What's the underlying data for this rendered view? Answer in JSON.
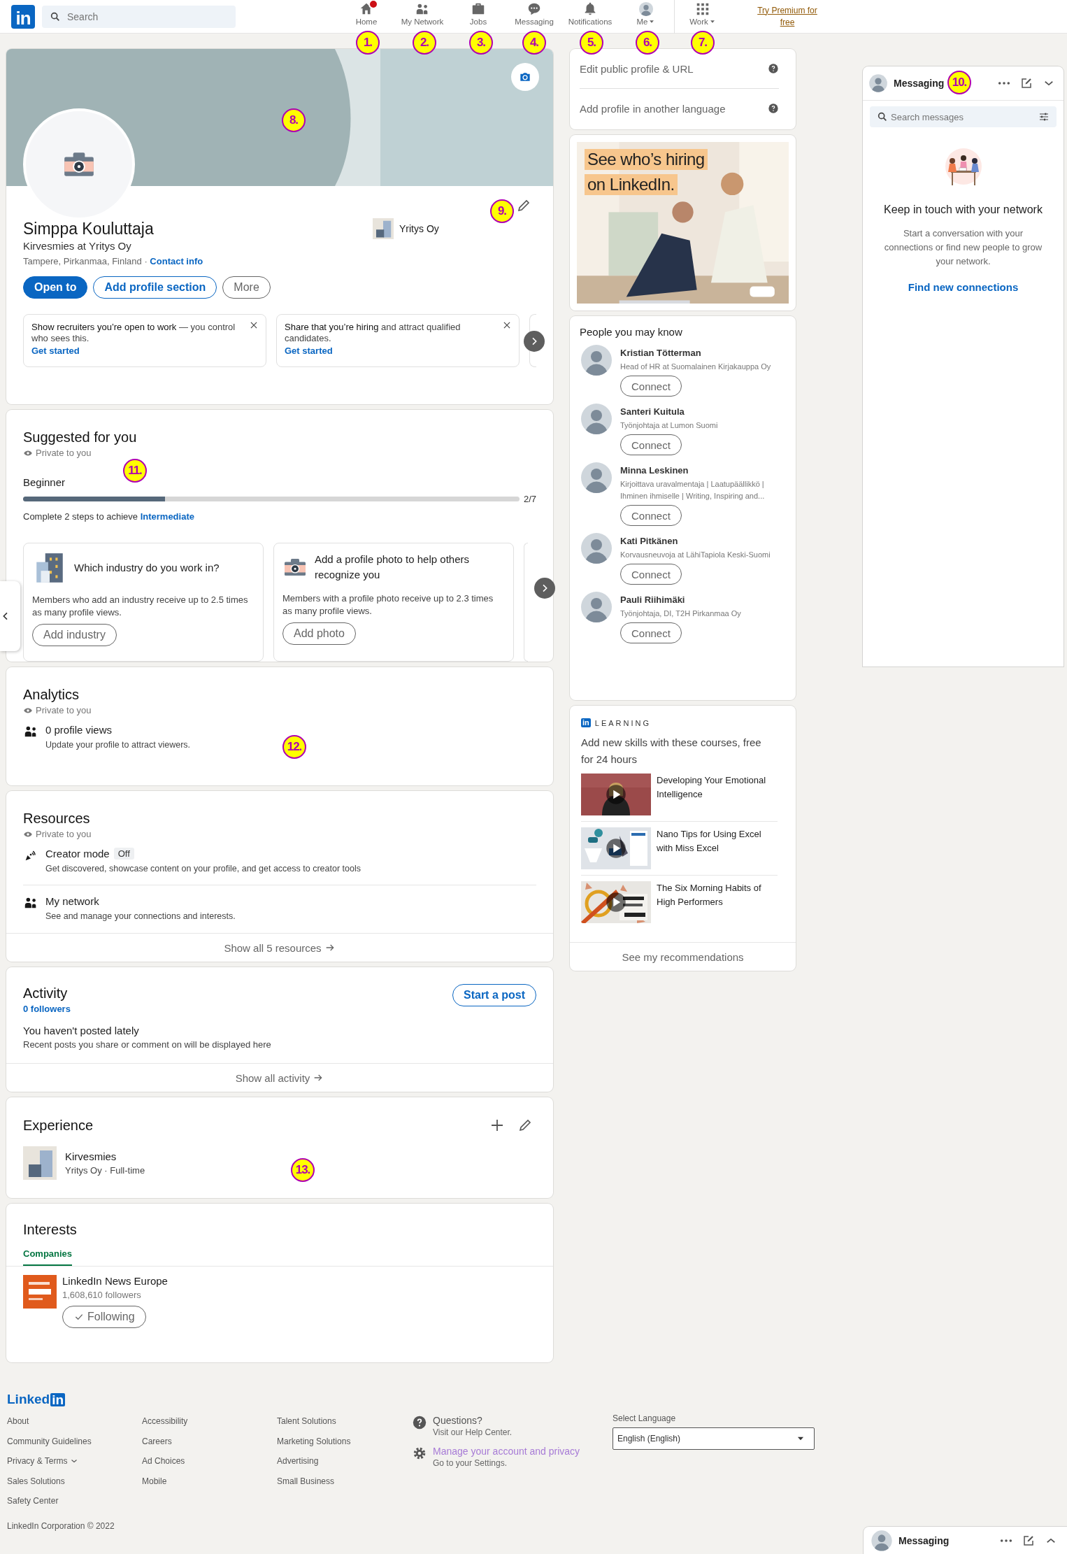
{
  "nav": {
    "logo": "in",
    "search": {
      "placeholder": "Search"
    },
    "items": [
      {
        "label": "Home",
        "badge": true,
        "dropdown": false
      },
      {
        "label": "My Network",
        "badge": false,
        "dropdown": false
      },
      {
        "label": "Jobs",
        "badge": false,
        "dropdown": false
      },
      {
        "label": "Messaging",
        "badge": false,
        "dropdown": false
      },
      {
        "label": "Notifications",
        "badge": false,
        "dropdown": false
      },
      {
        "label": "Me",
        "badge": false,
        "dropdown": true
      },
      {
        "label": "Work",
        "badge": false,
        "dropdown": true
      }
    ],
    "premium": "Try Premium for free"
  },
  "profile": {
    "name": "Simppa Kouluttaja",
    "headline": "Kirvesmies at Yritys Oy",
    "location": "Tampere, Pirkanmaa, Finland · ",
    "contact": "Contact info",
    "company": "Yritys Oy",
    "buttons": [
      {
        "label": "Open to",
        "kind": "primary"
      },
      {
        "label": "Add profile section",
        "kind": "outline"
      },
      {
        "label": "More",
        "kind": "secondary"
      }
    ],
    "prompts": [
      {
        "text": "**Show recruiters you’re open to work** — you control who sees this.",
        "link": "Get started"
      },
      {
        "text": "**Share that you’re hiring** and attract qualified candidates.",
        "link": "Get started"
      }
    ]
  },
  "suggested": {
    "title": "Suggested for you",
    "privacy": "Private to you",
    "level_label": "Beginner",
    "level": 0.286,
    "count": "2/7",
    "hint": "Complete 2 steps to achieve ",
    "hint_link": "Intermediate",
    "cards": [
      {
        "title": "Which industry do you work in?",
        "text": "Members who add an industry receive up to 2.5 times as many profile views.",
        "button": "Add industry"
      },
      {
        "title": "Add a profile photo to help others recognize you",
        "text": "Members with a profile photo receive up to 2.3 times as many profile views.",
        "button": "Add photo"
      }
    ]
  },
  "analytics": {
    "title": "Analytics",
    "privacy": "Private to you",
    "items": [
      {
        "title": "0 profile views",
        "text": "Update your profile to attract viewers."
      }
    ]
  },
  "resources": {
    "title": "Resources",
    "privacy": "Private to you",
    "items": [
      {
        "title": "Creator mode",
        "badge": "Off",
        "text": "Get discovered, showcase content on your profile, and get access to creator tools"
      },
      {
        "title": "My network",
        "text": "See and manage your connections and interests."
      }
    ],
    "footer": "Show all 5 resources"
  },
  "activity": {
    "title": "Activity",
    "followers": "0 followers",
    "button": "Start a post",
    "heading": "You haven't posted lately",
    "text": "Recent posts you share or comment on will be displayed here",
    "footer": "Show all activity"
  },
  "experience": {
    "title": "Experience",
    "items": [
      {
        "title": "Kirvesmies",
        "subtitle": "Yritys Oy · Full-time"
      }
    ]
  },
  "interests": {
    "title": "Interests",
    "tabs": [
      {
        "label": "Companies",
        "selected": true
      }
    ],
    "items": [
      {
        "name": "LinkedIn News Europe",
        "followers": "1,608,610 followers",
        "button": "Following"
      }
    ]
  },
  "sidebar": {
    "links": [
      {
        "label": "Edit public profile & URL"
      },
      {
        "label": "Add profile in another language"
      }
    ],
    "ad": {
      "lines": [
        "See who’s hiring",
        "on LinkedIn."
      ]
    },
    "people": {
      "title": "People you may know",
      "items": [
        {
          "name": "Kristian Tötterman",
          "headline": "Head of HR at Suomalainen Kirjakauppa Oy",
          "button": "Connect"
        },
        {
          "name": "Santeri Kuitula",
          "headline": "Työnjohtaja at Lumon Suomi",
          "button": "Connect"
        },
        {
          "name": "Minna Leskinen",
          "headline": "Kirjoittava uravalmentaja | Laatupäällikkö | Ihminen ihmiselle | Writing, Inspiring and...",
          "button": "Connect"
        },
        {
          "name": "Kati Pitkänen",
          "headline": "Korvausneuvoja at LähiTapiola Keski-Suomi",
          "button": "Connect"
        },
        {
          "name": "Pauli Riihimäki",
          "headline": "Työnjohtaja, DI, T2H Pirkanmaa Oy",
          "button": "Connect"
        }
      ]
    },
    "learning": {
      "logo": "in",
      "brand": "LEARNING",
      "title": "Add new skills with these courses, free for 24 hours",
      "courses": [
        {
          "title": "Developing Your Emotional Intelligence"
        },
        {
          "title": "Nano Tips for Using Excel with Miss Excel"
        },
        {
          "title": "The Six Morning Habits of High Performers"
        }
      ],
      "footer": "See my recommendations"
    }
  },
  "messaging": {
    "title": "Messaging",
    "search": {
      "placeholder": "Search messages"
    },
    "empty_title": "Keep in touch with your network",
    "empty_text": "Start a conversation with your connections or find new people to grow your network.",
    "link": "Find new connections"
  },
  "messaging_bar": {
    "title": "Messaging"
  },
  "footer": {
    "logo": [
      "Linked",
      "in"
    ],
    "columns": [
      [
        {
          "label": "About",
          "dropdown": false
        },
        {
          "label": "Community Guidelines",
          "dropdown": false
        },
        {
          "label": "Privacy & Terms",
          "dropdown": true
        },
        {
          "label": "Sales Solutions",
          "dropdown": false
        },
        {
          "label": "Safety Center",
          "dropdown": false
        }
      ],
      [
        {
          "label": "Accessibility",
          "dropdown": false
        },
        {
          "label": "Careers",
          "dropdown": false
        },
        {
          "label": "Ad Choices",
          "dropdown": false
        },
        {
          "label": "Mobile",
          "dropdown": false
        }
      ],
      [
        {
          "label": "Talent Solutions",
          "dropdown": false
        },
        {
          "label": "Marketing Solutions",
          "dropdown": false
        },
        {
          "label": "Advertising",
          "dropdown": false
        },
        {
          "label": "Small Business",
          "dropdown": false
        }
      ]
    ],
    "help": [
      {
        "title": "Questions?",
        "text": "Visit our Help Center.",
        "visited": false
      },
      {
        "title": "Manage your account and privacy",
        "text": "Go to your Settings.",
        "visited": true
      }
    ],
    "language": {
      "label": "Select Language",
      "value": "English (English)"
    },
    "copyright": "LinkedIn Corporation © 2022"
  },
  "annotations": [
    {
      "label": "1."
    },
    {
      "label": "2."
    },
    {
      "label": "3."
    },
    {
      "label": "4."
    },
    {
      "label": "5."
    },
    {
      "label": "6."
    },
    {
      "label": "7."
    },
    {
      "label": "8."
    },
    {
      "label": "9."
    },
    {
      "label": "10."
    },
    {
      "label": "11."
    },
    {
      "label": "12."
    },
    {
      "label": "13."
    }
  ]
}
